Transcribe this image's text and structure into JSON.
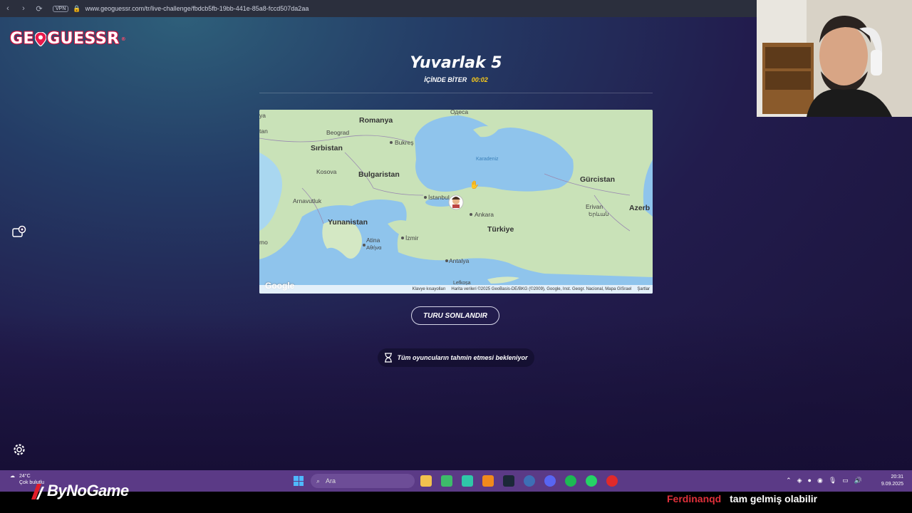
{
  "browser": {
    "vpn_label": "VPN",
    "url": "www.geoguessr.com/tr/live-challenge/fbdcb5fb-19bb-441e-85a8-fccd507da2aa",
    "icons": [
      "back-icon",
      "forward-icon",
      "reload-icon",
      "lock-icon"
    ]
  },
  "game": {
    "logo": "GEOGUESSR",
    "logo_parts": [
      "GE",
      "GUESSR"
    ],
    "title": "Yuvarlak 5",
    "ends_label": "İÇİNDE BİTER",
    "timer": "00:02",
    "end_round_button": "TURU SONLANDIR",
    "waiting_text": "Tüm oyuncuların tahmin etmesi bekleniyor"
  },
  "map": {
    "labels": {
      "odesa": "Одеса",
      "romanya": "Romanya",
      "beograd": "Beograd",
      "bukres": "Bukreş",
      "sirbistan": "Sırbistan",
      "karadeniz": "Karadeniz",
      "kosova": "Kosova",
      "bulgaristan": "Bulgaristan",
      "gurcistan": "Gürcistan",
      "arnavutluk": "Arnavutluk",
      "istanbul": "İstanbul",
      "erivan": "Erivan",
      "erivan_native": "Երևան",
      "azerb": "Azerb",
      "ankara": "Ankara",
      "yunanistan": "Yunanistan",
      "turkiye": "Türkiye",
      "izmir": "İzmir",
      "atina": "Atina",
      "atina_native": "Αθήνα",
      "antalya": "Antalya",
      "lefkosa": "Lefkoşa",
      "ya": "ya",
      "tan": "tan",
      "mo": "mo"
    },
    "google": "Google",
    "footer": [
      "Klavye kısayolları",
      "Harita verileri ©2025 GeoBasis-DE/BKG (©2009), Google, Inst. Geogr. Nacional, Mapa GISrael",
      "Şartlar"
    ]
  },
  "taskbar": {
    "temperature": "24°C",
    "weather": "Çok bulutlu",
    "search_placeholder": "Ara",
    "time": "20:31",
    "date": "9.09.2025"
  },
  "overlay": {
    "brand": "ByNoGame",
    "chat_user": "Ferdinanqd",
    "chat_message": "tam gelmiş olabilir"
  },
  "colors": {
    "accent_timer": "#fecd19",
    "logo_red": "#e91a4b",
    "taskbar": "#5b3a86"
  }
}
